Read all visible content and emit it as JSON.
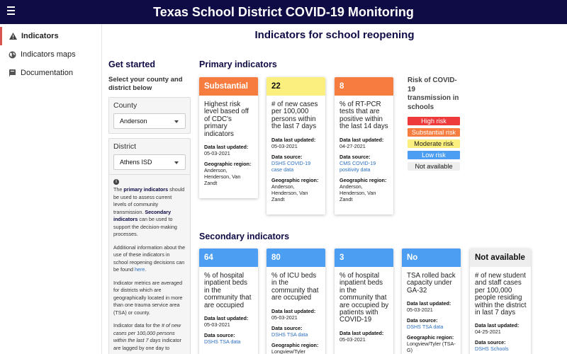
{
  "app_title": "Texas School District COVID-19 Monitoring",
  "nav": {
    "items": [
      {
        "label": "Indicators",
        "icon": "warning-icon"
      },
      {
        "label": "Indicators maps",
        "icon": "globe-icon"
      },
      {
        "label": "Documentation",
        "icon": "book-icon"
      }
    ]
  },
  "main": {
    "title": "Indicators for school reopening"
  },
  "left_panel": {
    "heading": "Get started",
    "select_prompt": "Select your county and district below",
    "county_label": "County",
    "county_value": "Anderson",
    "district_label": "District",
    "district_value": "Athens ISD"
  },
  "info": {
    "p1_pre": "The ",
    "p1_primary": "primary indicators",
    "p1_mid": " should be used to assess current levels of community transmission. ",
    "p1_secondary": "Secondary indicators",
    "p1_post": " can be used to support the decision-making processes.",
    "p2_pre": "Additional information about the use of these indicators in school reopening decisions can be found ",
    "p2_link": "here",
    "p2_post": ".",
    "p3": "Indicator metrics are averaged for districts which are geographically located in more than one trauma service area (TSA) or county.",
    "p4_pre": "Indicator data for the ",
    "p4_em": "# of new cases per 100,000 persons within the last 7 days",
    "p4_post": " indicator are lagged by one day to"
  },
  "labels": {
    "data_last_updated": "Data last updated:",
    "data_source": "Data source:",
    "geographic_region": "Geographic region:"
  },
  "primary": {
    "title": "Primary indicators",
    "cards": [
      {
        "value": "Substantial",
        "desc": "Highest risk level based off of CDC's primary indicators",
        "updated": "05-03-2021",
        "source": "",
        "region": "Anderson, Henderson, Van Zandt"
      },
      {
        "value": "22",
        "desc": "# of new cases per 100,000 persons within the last 7 days",
        "updated": "05-03-2021",
        "source": "DSHS COVID-19 case data",
        "region": "Anderson, Henderson, Van Zandt"
      },
      {
        "value": "8",
        "desc": "% of RT-PCR tests that are positive within the last 14 days",
        "updated": "04-27-2021",
        "source": "CMS COVID-19 positivity data",
        "region": "Anderson, Henderson, Van Zandt"
      }
    ]
  },
  "legend": {
    "title": "Risk of COVID-19 transmission in schools",
    "items": [
      {
        "label": "High risk",
        "color": "#ee3a3a",
        "text": "#ffffff"
      },
      {
        "label": "Substantial risk",
        "color": "#f67d3f",
        "text": "#ffffff"
      },
      {
        "label": "Moderate risk",
        "color": "#fbf07e",
        "text": "#222222"
      },
      {
        "label": "Low risk",
        "color": "#4c9ef2",
        "text": "#ffffff"
      },
      {
        "label": "Not available",
        "color": "#eeeeee",
        "text": "#111111"
      }
    ]
  },
  "secondary": {
    "title": "Secondary indicators",
    "cards": [
      {
        "value": "64",
        "desc": "% of hospital inpatient beds in the community that are occupied",
        "updated": "05-03-2021",
        "source": "DSHS TSA data",
        "region": ""
      },
      {
        "value": "80",
        "desc": "% of ICU beds in the community that are occupied",
        "updated": "05-03-2021",
        "source": "DSHS TSA data",
        "region": "Longview/Tyler"
      },
      {
        "value": "3",
        "desc": "% of hospital inpatient beds in the community that are occupied by patients with COVID-19",
        "updated": "05-03-2021",
        "source": "",
        "region": ""
      },
      {
        "value": "No",
        "desc": "TSA rolled back capacity under GA-32",
        "updated": "05-03-2021",
        "source": "DSHS TSA data",
        "region": "Longview/Tyler (TSA-G)"
      },
      {
        "value": "Not available",
        "desc": "# of new student and staff cases per 100,000 people residing within the district in last 7 days",
        "updated": "04-25-2021",
        "source": "DSHS Schools",
        "region": ""
      }
    ]
  },
  "colors": {
    "header_bg": "#0e0b45",
    "substantial": "#f67d3f",
    "moderate": "#fbf07e",
    "low": "#4c9ef2",
    "not_available": "#eeeeee"
  }
}
